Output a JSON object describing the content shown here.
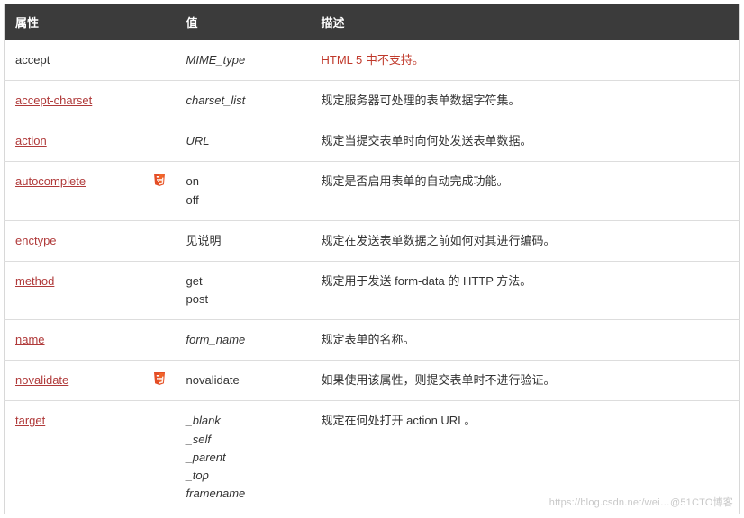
{
  "header": {
    "attr": "属性",
    "value": "值",
    "desc": "描述"
  },
  "rows": [
    {
      "attr": "accept",
      "link": false,
      "h5": false,
      "values": [
        "MIME_type"
      ],
      "italic": true,
      "desc": "HTML 5 中不支持。",
      "desc_red": true
    },
    {
      "attr": "accept-charset",
      "link": true,
      "h5": false,
      "values": [
        "charset_list"
      ],
      "italic": true,
      "desc": "规定服务器可处理的表单数据字符集。",
      "desc_red": false
    },
    {
      "attr": "action",
      "link": true,
      "h5": false,
      "values": [
        "URL"
      ],
      "italic": true,
      "desc": "规定当提交表单时向何处发送表单数据。",
      "desc_red": false
    },
    {
      "attr": "autocomplete",
      "link": true,
      "h5": true,
      "values": [
        "on",
        "off"
      ],
      "italic": false,
      "desc": "规定是否启用表单的自动完成功能。",
      "desc_red": false
    },
    {
      "attr": "enctype",
      "link": true,
      "h5": false,
      "values": [
        "见说明"
      ],
      "italic": false,
      "desc": "规定在发送表单数据之前如何对其进行编码。",
      "desc_red": false
    },
    {
      "attr": "method",
      "link": true,
      "h5": false,
      "values": [
        "get",
        "post"
      ],
      "italic": false,
      "desc": "规定用于发送 form-data 的 HTTP 方法。",
      "desc_red": false
    },
    {
      "attr": "name",
      "link": true,
      "h5": false,
      "values": [
        "form_name"
      ],
      "italic": true,
      "desc": "规定表单的名称。",
      "desc_red": false
    },
    {
      "attr": "novalidate",
      "link": true,
      "h5": true,
      "values": [
        "novalidate"
      ],
      "italic": false,
      "desc": "如果使用该属性，则提交表单时不进行验证。",
      "desc_red": false
    },
    {
      "attr": "target",
      "link": true,
      "h5": false,
      "values": [
        "_blank",
        "_self",
        "_parent",
        "_top",
        "framename"
      ],
      "italic": true,
      "desc": "规定在何处打开 action URL。",
      "desc_red": false
    }
  ],
  "watermark": "https://blog.csdn.net/wei…@51CTO博客"
}
